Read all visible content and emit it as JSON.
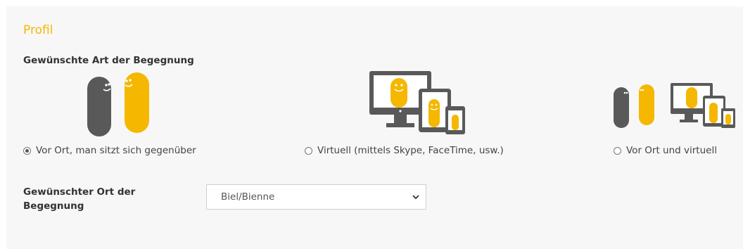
{
  "section": {
    "title": "Profil"
  },
  "encounter_type": {
    "label": "Gewünschte Art der Begegnung",
    "options": [
      {
        "label": "Vor Ort, man sitzt sich gegenüber",
        "selected": true
      },
      {
        "label": "Virtuell (mittels Skype, FaceTime, usw.)",
        "selected": false
      },
      {
        "label": "Vor Ort und virtuell",
        "selected": false
      }
    ]
  },
  "location": {
    "label_line1": "Gewünschter Ort der",
    "label_line2": "Begegnung",
    "value": "Biel/Bienne"
  },
  "colors": {
    "accent": "#f5b700",
    "gray_figure": "#595959",
    "panel": "#f7f7f7"
  }
}
